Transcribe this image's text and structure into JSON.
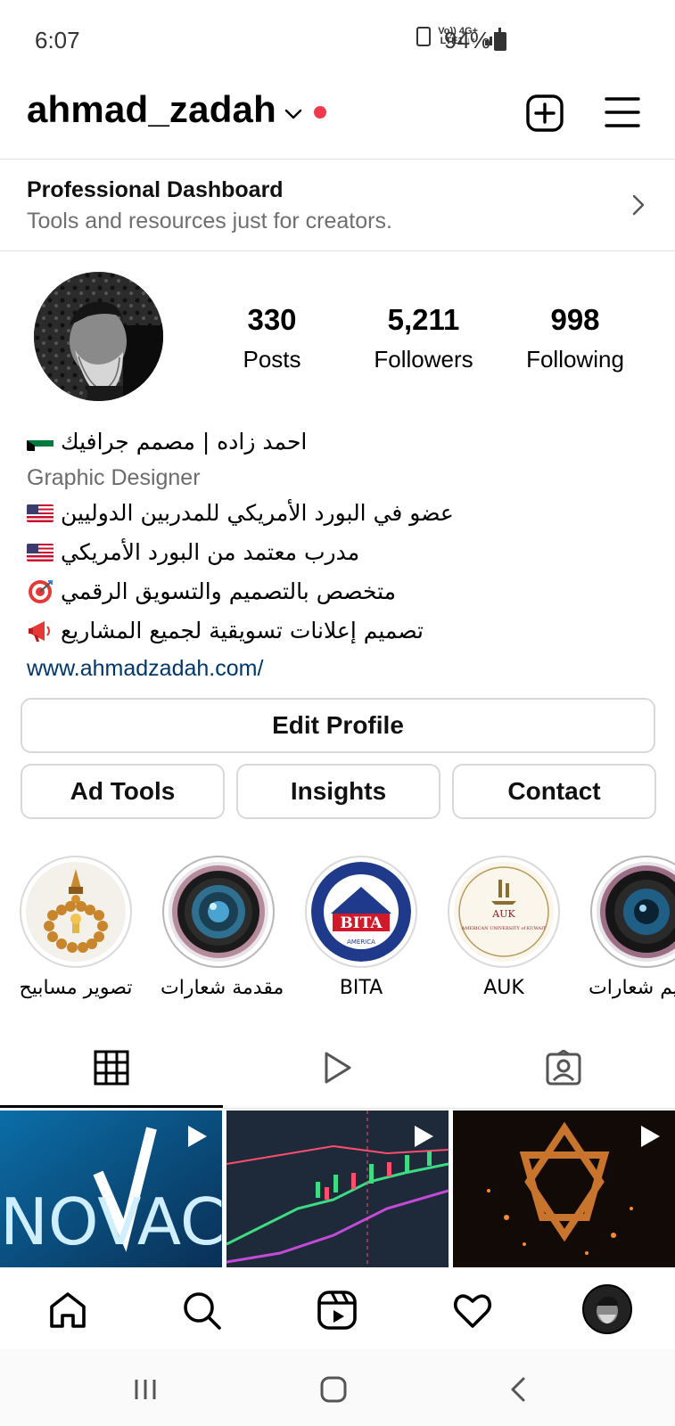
{
  "status_bar": {
    "time": "6:07",
    "network_top": "Vo)) 4G+",
    "network_bottom": "LTE1 ↓↑",
    "battery": "94%"
  },
  "header": {
    "username": "ahmad_zadah"
  },
  "dashboard": {
    "title": "Professional Dashboard",
    "subtitle": "Tools and resources just for creators."
  },
  "stats": {
    "posts_count": "330",
    "posts_label": "Posts",
    "followers_count": "5,211",
    "followers_label": "Followers",
    "following_count": "998",
    "following_label": "Following"
  },
  "bio": {
    "name": "احمد زاده | مصمم جرافيك",
    "category": "Graphic Designer",
    "line1": "عضو في البورد الأمريكي للمدربين الدوليين",
    "line2": "مدرب معتمد من البورد الأمريكي",
    "line3": "متخصص بالتصميم والتسويق الرقمي",
    "line4": "تصميم إعلانات تسويقية لجميع المشاريع",
    "link": "www.ahmadzadah.com/"
  },
  "buttons": {
    "edit_profile": "Edit Profile",
    "ad_tools": "Ad Tools",
    "insights": "Insights",
    "contact": "Contact"
  },
  "highlights": [
    {
      "label": "تصوير مسابيح",
      "icon": "prayer-beads"
    },
    {
      "label": "مقدمة شعارات",
      "icon": "camera-lens"
    },
    {
      "label": "BITA",
      "icon": "bita-logo",
      "logo_text": "BITA",
      "logo_sub": "AMERICA"
    },
    {
      "label": "AUK",
      "icon": "auk-logo",
      "logo_text": "AUK",
      "logo_sub": "AMERICAN UNIVERSITY of KUWAIT"
    },
    {
      "label": "تصميم شعارات",
      "icon": "camera-lens-blue"
    }
  ],
  "posts": [
    {
      "type": "reel",
      "text": "NOVAC"
    },
    {
      "type": "reel",
      "text": ""
    },
    {
      "type": "reel",
      "text": ""
    }
  ],
  "colors": {
    "notification_dot": "#ef3a4f",
    "link": "#00376b",
    "muted_text": "#6c6c6c"
  }
}
